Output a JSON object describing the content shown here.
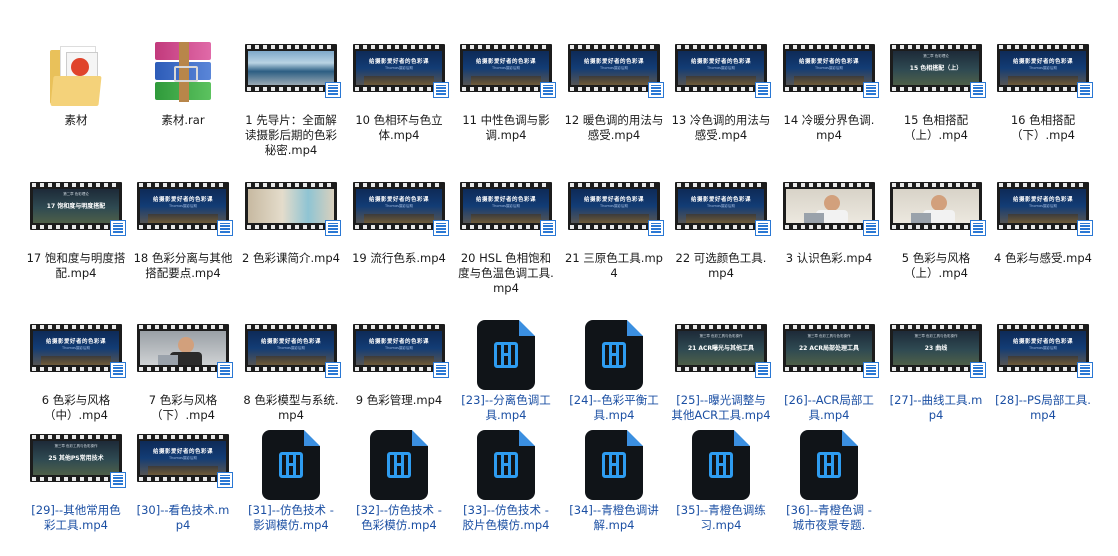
{
  "items": [
    {
      "label": "素材",
      "kind": "folder"
    },
    {
      "label": "素材.rar",
      "kind": "rar"
    },
    {
      "label": "1 先导片：全面解读摄影后期的色彩秘密.mp4",
      "kind": "photo-sea"
    },
    {
      "label": "10 色相环与色立体.mp4",
      "kind": "slide"
    },
    {
      "label": "11 中性色调与影调.mp4",
      "kind": "slide"
    },
    {
      "label": "12 暖色调的用法与感受.mp4",
      "kind": "slide"
    },
    {
      "label": "13 冷色调的用法与感受.mp4",
      "kind": "slide"
    },
    {
      "label": "14 冷暖分界色调.mp4",
      "kind": "slide"
    },
    {
      "label": "15 色相搭配（上）.mp4",
      "kind": "chap"
    },
    {
      "label": "16 色相搭配（下）.mp4",
      "kind": "slide"
    },
    {
      "label": "17 饱和度与明度搭配.mp4",
      "kind": "chap"
    },
    {
      "label": "18 色彩分离与其他搭配要点.mp4",
      "kind": "slide"
    },
    {
      "label": "2 色彩课简介.mp4",
      "kind": "photo-room"
    },
    {
      "label": "19 流行色系.mp4",
      "kind": "slide"
    },
    {
      "label": "20 HSL 色相饱和度与色温色调工具.mp4",
      "kind": "slide"
    },
    {
      "label": "21 三原色工具.mp4",
      "kind": "slide"
    },
    {
      "label": "22 可选颜色工具.mp4",
      "kind": "slide"
    },
    {
      "label": "3 认识色彩.mp4",
      "kind": "man"
    },
    {
      "label": "5 色彩与风格（上）.mp4",
      "kind": "man"
    },
    {
      "label": "4 色彩与感受.mp4",
      "kind": "slide"
    },
    {
      "label": "6 色彩与风格（中）.mp4",
      "kind": "slide"
    },
    {
      "label": "7 色彩与风格（下）.mp4",
      "kind": "man2"
    },
    {
      "label": "8 色彩模型与系统.mp4",
      "kind": "slide"
    },
    {
      "label": "9 色彩管理.mp4",
      "kind": "slide"
    },
    {
      "label": "[23]--分离色调工具.mp4",
      "kind": "vfile"
    },
    {
      "label": "[24]--色彩平衡工具.mp4",
      "kind": "vfile"
    },
    {
      "label": "[25]--曝光调整与其他ACR工具.mp4",
      "kind": "chap"
    },
    {
      "label": "[26]--ACR局部工具.mp4",
      "kind": "chap"
    },
    {
      "label": "[27]--曲线工具.mp4",
      "kind": "chap"
    },
    {
      "label": "[28]--PS局部工具.mp4",
      "kind": "slide"
    },
    {
      "label": "[29]--其他常用色彩工具.mp4",
      "kind": "chap"
    },
    {
      "label": "[30]--看色技术.mp4",
      "kind": "slide"
    },
    {
      "label": "[31]--仿色技术 - 影调模仿.mp4",
      "kind": "vfile"
    },
    {
      "label": "[32]--仿色技术 - 色彩模仿.mp4",
      "kind": "vfile"
    },
    {
      "label": "[33]--仿色技术 - 胶片色模仿.mp4",
      "kind": "vfile"
    },
    {
      "label": "[34]--青橙色调讲解.mp4",
      "kind": "vfile"
    },
    {
      "label": "[35]--青橙色调练习.mp4",
      "kind": "vfile"
    },
    {
      "label": "[36]--青橙色调 - 城市夜景专题.",
      "kind": "vfile"
    }
  ],
  "slide_text": {
    "title": "给摄影爱好者的色彩课",
    "subtitle": "Thomas摄影后期"
  },
  "chap_text": {
    "15 色相搭配（上）.mp4": {
      "top": "第二章 色彩理论",
      "title": "15 色相搭配（上）"
    },
    "17 饱和度与明度搭配.mp4": {
      "top": "第二章 色彩理论",
      "title": "17 饱和度与明度搭配"
    },
    "[25]--曝光调整与其他ACR工具.mp4": {
      "top": "第三章 色彩工具与色彩操作",
      "title": "21 ACR曝光与其他工具"
    },
    "[26]--ACR局部工具.mp4": {
      "top": "第三章 色彩工具与色彩操作",
      "title": "22 ACR局部处理工具"
    },
    "[27]--曲线工具.mp4": {
      "top": "第三章 色彩工具与色彩操作",
      "title": "23 曲线"
    },
    "[29]--其他常用色彩工具.mp4": {
      "top": "第三章 色彩工具与色彩操作",
      "title": "25 其他PS常用技术"
    }
  },
  "colors": {
    "label": "#1a1a1a",
    "label_bracket": "#1b4fa3",
    "accent": "#2e9cf0"
  }
}
